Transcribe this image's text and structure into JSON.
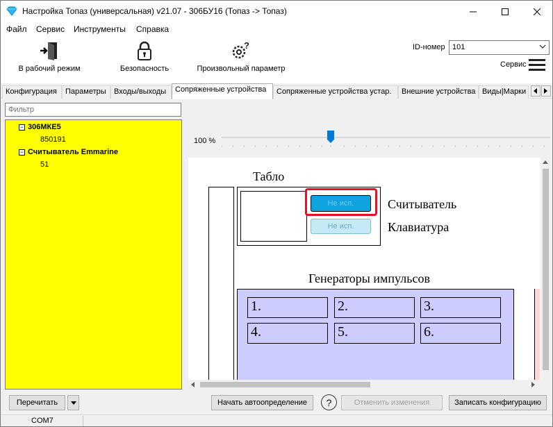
{
  "window": {
    "title": "Настройка Топаз (универсальная) v21.07 - 306БУ16 (Топаз -> Топаз)"
  },
  "menu": [
    "Файл",
    "Сервис",
    "Инструменты",
    "Справка"
  ],
  "toolbar": {
    "work_mode": "В рабочий режим",
    "security": "Безопасность",
    "arbitrary_param": "Произвольный параметр",
    "id_label": "ID-номер",
    "id_value": "101",
    "service_label": "Сервис"
  },
  "tabs": [
    "Конфигурация",
    "Параметры",
    "Входы/выходы",
    "Сопряженные устройства",
    "Сопряженные устройства устар.",
    "Внешние устройства",
    "Виды|Марки"
  ],
  "filter": {
    "placeholder": "Фильтр"
  },
  "tree": [
    {
      "label": "306МКЕ5",
      "child": "850191"
    },
    {
      "label": "Считыватель Emmarine",
      "child": "51"
    }
  ],
  "zoom": {
    "label": "100 %",
    "value_percent": 100
  },
  "diagram": {
    "tablo_title": "Табло",
    "reader_button": "Не исп.",
    "keypad_button": "Не исп.",
    "reader_label": "Считыватель",
    "keypad_label": "Клавиатура",
    "generators_title": "Генераторы импульсов",
    "generators": [
      "1.",
      "2.",
      "3.",
      "4.",
      "5.",
      "6."
    ]
  },
  "buttons": {
    "reread": "Перечитать",
    "autodetect": "Начать автоопределение",
    "help": "?",
    "cancel_changes": "Отменить изменения",
    "write_config": "Записать конфигурацию"
  },
  "status": {
    "port": "COM7"
  },
  "colors": {
    "tree_bg": "#ffff00",
    "accent": "#0078d7",
    "highlight": "#e81123",
    "generator_bg": "#ccccff"
  }
}
